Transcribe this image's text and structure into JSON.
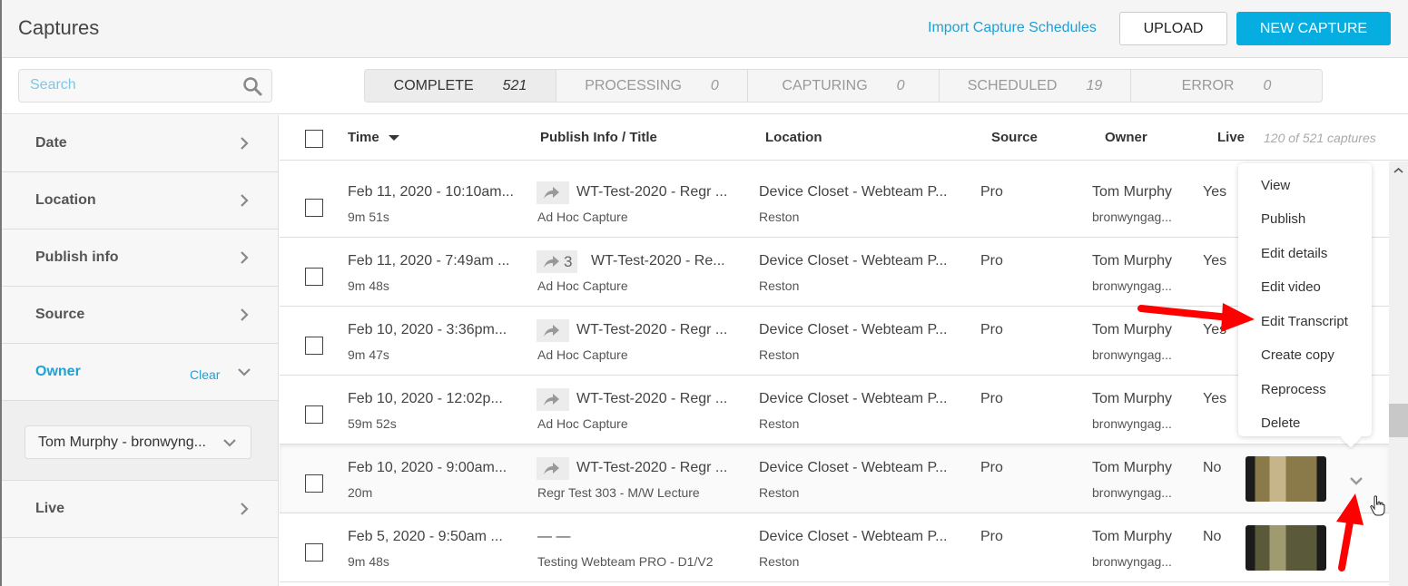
{
  "header": {
    "title": "Captures",
    "import_link": "Import Capture Schedules",
    "upload_label": "UPLOAD",
    "new_capture_label": "NEW CAPTURE"
  },
  "search": {
    "placeholder": "Search",
    "value": ""
  },
  "status_tabs": [
    {
      "label": "COMPLETE",
      "count": "521",
      "active": true
    },
    {
      "label": "PROCESSING",
      "count": "0"
    },
    {
      "label": "CAPTURING",
      "count": "0"
    },
    {
      "label": "SCHEDULED",
      "count": "19"
    },
    {
      "label": "ERROR",
      "count": "0"
    }
  ],
  "sidebar": {
    "filters": [
      {
        "label": "Date"
      },
      {
        "label": "Location"
      },
      {
        "label": "Publish info"
      },
      {
        "label": "Source"
      },
      {
        "label": "Owner",
        "clear_label": "Clear",
        "expanded": true,
        "selected": "Tom Murphy - bronwyng..."
      },
      {
        "label": "Live"
      }
    ]
  },
  "table": {
    "columns": [
      "Time",
      "Publish Info / Title",
      "Location",
      "Source",
      "Owner",
      "Live"
    ],
    "sort_column": "Time",
    "count_label": "120 of 521 captures",
    "rows": [
      {
        "time": "Feb 11, 2020 - 10:10am...",
        "duration": "9m 51s",
        "publish_count": "",
        "title": "WT-Test-2020 - Regr ...",
        "subtitle": "Ad Hoc Capture",
        "location": "Device Closet - Webteam P...",
        "location_sub": "Reston",
        "source": "Pro",
        "owner": "Tom Murphy",
        "owner_sub": "bronwyngag...",
        "live": "Yes"
      },
      {
        "time": "Feb 11, 2020 - 7:49am ...",
        "duration": "9m 48s",
        "publish_count": "3",
        "title": "WT-Test-2020 - Re...",
        "subtitle": "Ad Hoc Capture",
        "location": "Device Closet - Webteam P...",
        "location_sub": "Reston",
        "source": "Pro",
        "owner": "Tom Murphy",
        "owner_sub": "bronwyngag...",
        "live": "Yes"
      },
      {
        "time": "Feb 10, 2020 - 3:36pm...",
        "duration": "9m 47s",
        "publish_count": "",
        "title": "WT-Test-2020 - Regr ...",
        "subtitle": "Ad Hoc Capture",
        "location": "Device Closet - Webteam P...",
        "location_sub": "Reston",
        "source": "Pro",
        "owner": "Tom Murphy",
        "owner_sub": "bronwyngag...",
        "live": "Yes"
      },
      {
        "time": "Feb 10, 2020 - 12:02p...",
        "duration": "59m 52s",
        "publish_count": "",
        "title": "WT-Test-2020 - Regr ...",
        "subtitle": "Ad Hoc Capture",
        "location": "Device Closet - Webteam P...",
        "location_sub": "Reston",
        "source": "Pro",
        "owner": "Tom Murphy",
        "owner_sub": "bronwyngag...",
        "live": "Yes"
      },
      {
        "time": "Feb 10, 2020 - 9:00am...",
        "duration": "20m",
        "publish_count": "",
        "title": "WT-Test-2020 - Regr ...",
        "subtitle": "Regr Test 303 - M/W Lecture",
        "location": "Device Closet - Webteam P...",
        "location_sub": "Reston",
        "source": "Pro",
        "owner": "Tom Murphy",
        "owner_sub": "bronwyngag...",
        "live": "No"
      },
      {
        "time": "Feb 5, 2020 - 9:50am ...",
        "duration": "9m 48s",
        "publish_count": "",
        "title": "— —",
        "subtitle": "Testing Webteam PRO - D1/V2",
        "location": "Device Closet - Webteam P...",
        "location_sub": "Reston",
        "source": "Pro",
        "owner": "Tom Murphy",
        "owner_sub": "bronwyngag...",
        "live": "No"
      }
    ]
  },
  "context_menu": {
    "items": [
      "View",
      "Publish",
      "Edit details",
      "Edit video",
      "Edit Transcript",
      "Create copy",
      "Reprocess",
      "Delete"
    ]
  },
  "colors": {
    "accent": "#06ade1",
    "link": "#1ea1d6",
    "annotation_arrow": "#ff0000"
  }
}
